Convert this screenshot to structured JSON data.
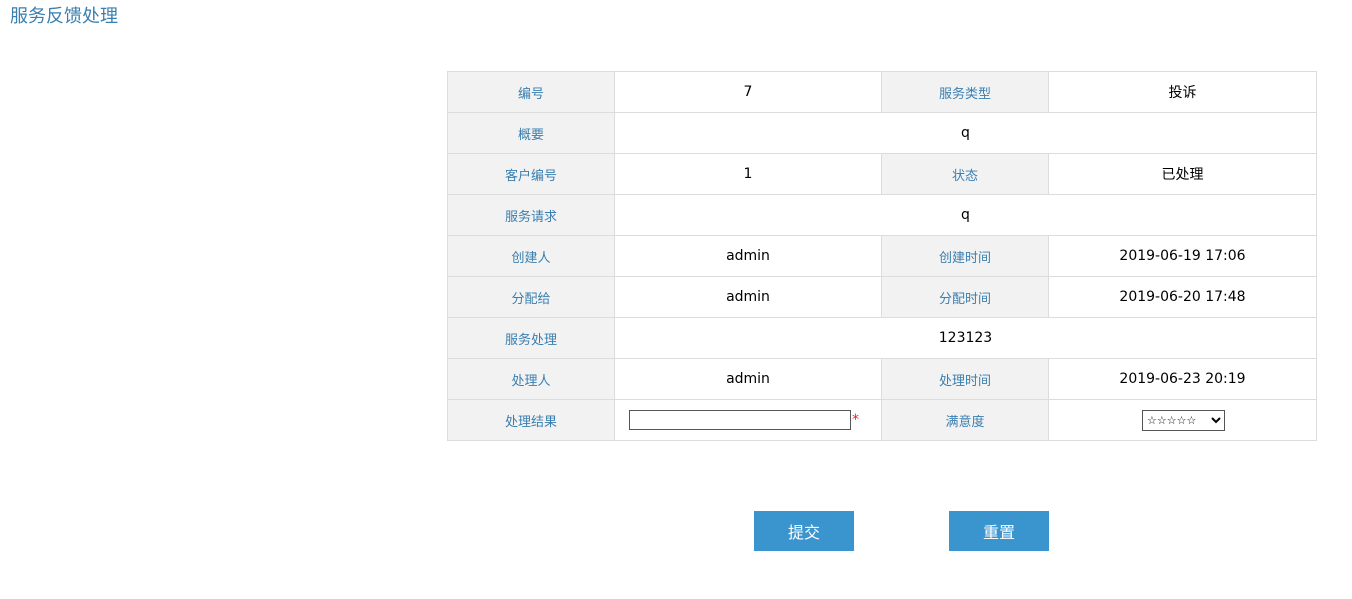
{
  "page": {
    "title": "服务反馈处理"
  },
  "table": {
    "id_label": "编号",
    "id_value": "7",
    "type_label": "服务类型",
    "type_value": "投诉",
    "summary_label": "概要",
    "summary_value": "q",
    "customer_id_label": "客户编号",
    "customer_id_value": "1",
    "status_label": "状态",
    "status_value": "已处理",
    "request_label": "服务请求",
    "request_value": "q",
    "creator_label": "创建人",
    "creator_value": "admin",
    "created_time_label": "创建时间",
    "created_time_value": "2019-06-19 17:06",
    "assignee_label": "分配给",
    "assignee_value": "admin",
    "assigned_time_label": "分配时间",
    "assigned_time_value": "2019-06-20 17:48",
    "handling_label": "服务处理",
    "handling_value": "123123",
    "handler_label": "处理人",
    "handler_value": "admin",
    "handled_time_label": "处理时间",
    "handled_time_value": "2019-06-23 20:19",
    "result_label": "处理结果",
    "result_value": "",
    "required_mark": "*",
    "satisfaction_label": "满意度",
    "satisfaction_selected": "☆☆☆☆☆"
  },
  "buttons": {
    "submit_label": "提交",
    "reset_label": "重置"
  },
  "colors": {
    "title": "#3a7fb0",
    "label_bg": "#f2f2f2",
    "label_text": "#3a7fb0",
    "button_bg": "#3a95cf",
    "required": "#e0262c",
    "border": "#dcdcdc"
  }
}
